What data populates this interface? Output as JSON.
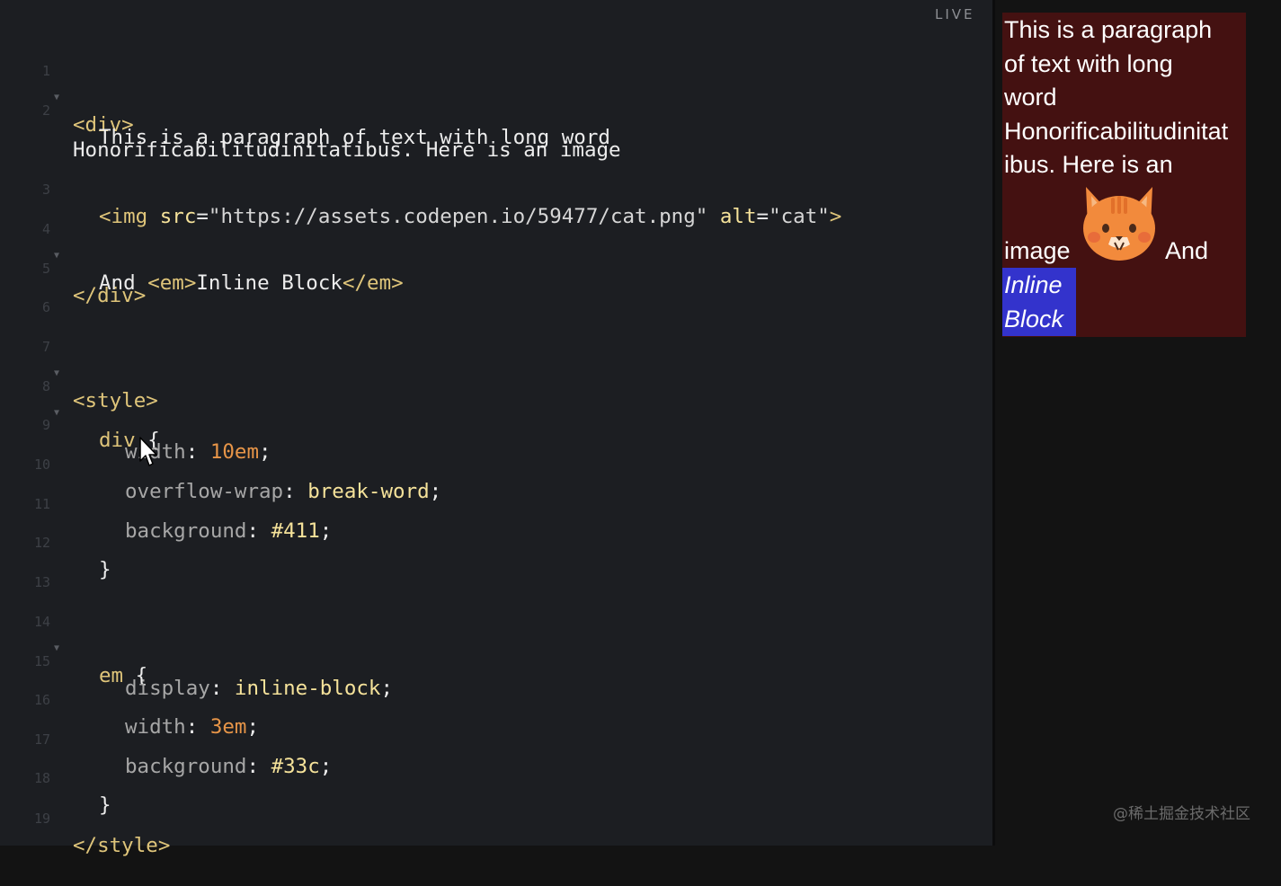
{
  "live_label": "LIVE",
  "watermark": "@稀土掘金技术社区",
  "colors": {
    "div_bg": "#441111",
    "em_bg": "#3333cc",
    "editor_bg": "#1c1e22"
  },
  "lines": {
    "n1": "1",
    "n2": "2",
    "n3": "3",
    "n4": "4",
    "n5": "5",
    "n6": "6",
    "n7": "7",
    "n8": "8",
    "n9": "9",
    "n10": "10",
    "n11": "11",
    "n12": "12",
    "n13": "13",
    "n14": "14",
    "n15": "15",
    "n16": "16",
    "n17": "17",
    "n18": "18",
    "n19": "19"
  },
  "code": {
    "l1_tag": "<div>",
    "l2a": "This is a paragraph of text with long word",
    "l2b": "Honorificabilitudinitatibus. Here is an image",
    "l3_open": "<img",
    "l3_src": "src",
    "l3_eq1": "=",
    "l3_url": "\"https://assets.codepen.io/59477/cat.png\"",
    "l3_alt": "alt",
    "l3_eq2": "=",
    "l3_altval": "\"cat\"",
    "l3_close": ">",
    "l4_and": "And",
    "l4_em_open": "<em>",
    "l4_text": "Inline Block",
    "l4_em_close": "</em>",
    "l5_tag": "</div>",
    "l7_tag": "<style>",
    "l8_sel": "div",
    "l8_brace": "{",
    "l9_prop": "width",
    "l9_colon": ":",
    "l9_val": "10em",
    "l9_semi": ";",
    "l10_prop": "overflow-wrap",
    "l10_colon": ":",
    "l10_val": "break-word",
    "l10_semi": ";",
    "l11_prop": "background",
    "l11_colon": ":",
    "l11_val": "#411",
    "l11_semi": ";",
    "l12_brace": "}",
    "l14_sel": "em",
    "l14_brace": "{",
    "l15_prop": "display",
    "l15_colon": ":",
    "l15_val": "inline-block",
    "l15_semi": ";",
    "l16_prop": "width",
    "l16_colon": ":",
    "l16_val": "3em",
    "l16_semi": ";",
    "l17_prop": "background",
    "l17_colon": ":",
    "l17_val": "#33c",
    "l17_semi": ";",
    "l18_brace": "}",
    "l19_tag": "</style>"
  },
  "preview": {
    "line1": "This is a paragraph",
    "line2": "of text with long",
    "line3": "word",
    "line4": "Honorificabilitudinitat",
    "line5": "ibus. Here is an",
    "line6_image": "image",
    "line6_and": "And",
    "em_line1": "Inline",
    "em_line2": "Block"
  }
}
